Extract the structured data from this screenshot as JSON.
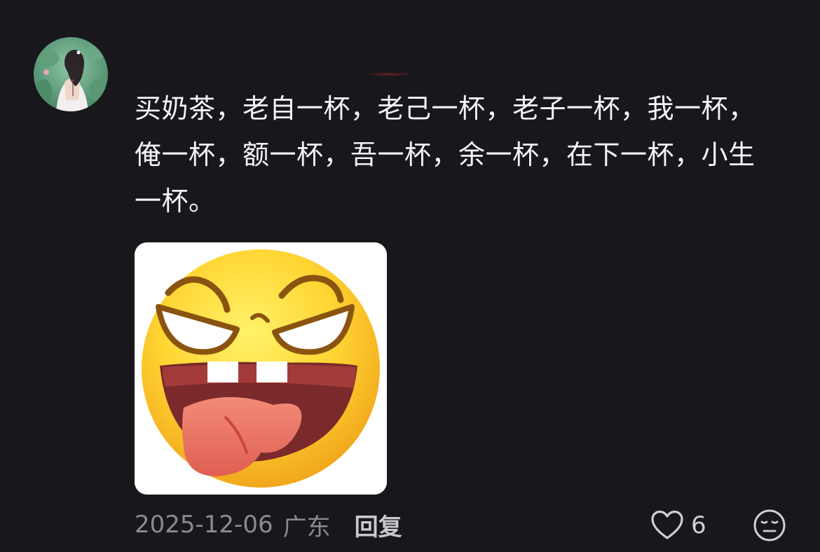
{
  "comment": {
    "username": "",
    "text": "买奶茶，老自一杯，老己一杯，老子一杯，我一杯，俺一杯，额一杯，吾一杯，余一杯，在下一杯，小生一杯。",
    "avatar_icon": "avatar-photo",
    "sticker_icon": "grinning-tongue-out-emoji",
    "date": "2025-12-06",
    "location": "广东",
    "reply_label": "回复",
    "like_count": "6",
    "like_icon": "heart-outline-icon",
    "emoji_icon": "emoji-face-icon"
  },
  "colors": {
    "background": "#18171c",
    "text": "#f4f4f6",
    "meta_text": "#8b8a91",
    "reply_text": "#c9c8ce"
  }
}
